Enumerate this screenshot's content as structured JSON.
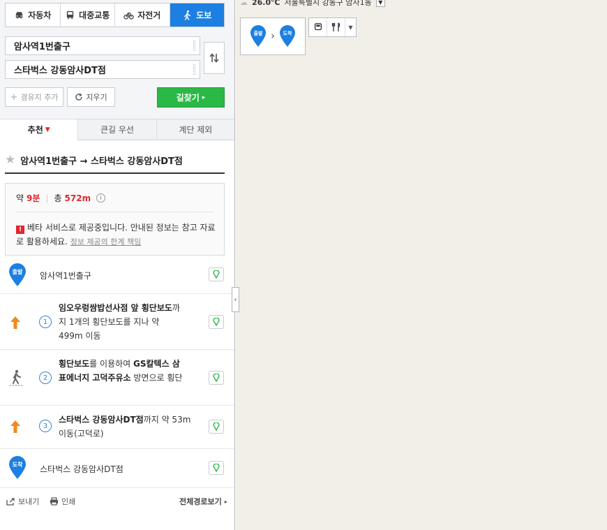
{
  "modes": [
    {
      "label": "자동차",
      "icon": "car-icon",
      "active": false
    },
    {
      "label": "대중교통",
      "icon": "bus-icon",
      "active": false
    },
    {
      "label": "자전거",
      "icon": "bicycle-icon",
      "active": false
    },
    {
      "label": "도보",
      "icon": "walk-icon",
      "active": true
    }
  ],
  "search": {
    "from": "암사역1번출구",
    "to": "스타벅스 강동암사DT점",
    "add_waypoint": "경유지 추가",
    "clear": "지우기",
    "submit": "길찾기"
  },
  "options": [
    {
      "label": "추천",
      "active": true
    },
    {
      "label": "큰길 우선",
      "active": false
    },
    {
      "label": "계단 제외",
      "active": false
    }
  ],
  "route": {
    "title": "암사역1번출구 → 스타벅스 강동암사DT점",
    "approx": "약",
    "time": "9분",
    "total": "총",
    "distance": "572m",
    "beta_notice": "베타 서비스로 제공중입니다. 안내된 정보는 참고 자료로 활용하세요.",
    "beta_link": "정보 제공의 한계 책임"
  },
  "steps": [
    {
      "type": "start",
      "badge": "출발",
      "text": "암사역1번출구"
    },
    {
      "type": "step",
      "num": "1",
      "icon": "arrow-up-icon",
      "bold": "임오우렁쌈밥선사점 앞 횡단보도",
      "rest": "까지 1개의 횡단보도를 지나 약 499m 이동"
    },
    {
      "type": "step",
      "num": "2",
      "icon": "pedestrian-icon",
      "bold": "횡단보도",
      "rest_a": "를 이용하여 ",
      "bold2": "GS칼텍스 삼표에너지 고덕주유소",
      "rest": " 방면으로 횡단"
    },
    {
      "type": "step",
      "num": "3",
      "icon": "arrow-up-icon",
      "bold": "스타벅스 강동암사DT점",
      "rest": "까지 약 53m 이동(고덕로)"
    },
    {
      "type": "end",
      "badge": "도착",
      "text": "스타벅스 강동암사DT점"
    }
  ],
  "footer": {
    "share": "보내기",
    "print": "인쇄",
    "full_route": "전체경로보기"
  },
  "map": {
    "temperature": "26.0℃",
    "location": "서울특별시 강동구 암사1동",
    "legend_start": "출발",
    "legend_end": "도착",
    "start_marker": "출발",
    "end_marker": "도착"
  },
  "colors": {
    "accent": "#1d7fe1",
    "search_button": "#2ab847",
    "route": "#3b8de8",
    "highlight": "#e3262f"
  }
}
